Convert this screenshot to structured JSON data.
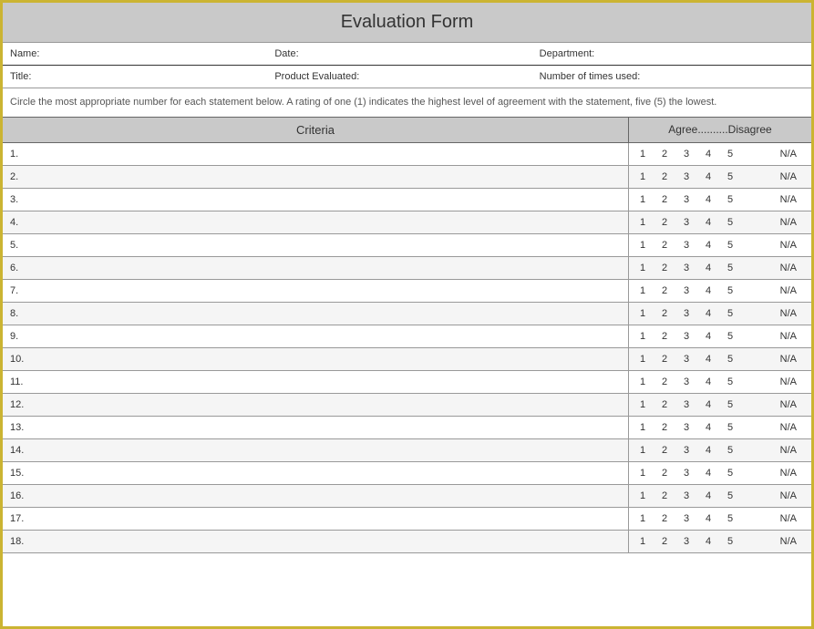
{
  "title": "Evaluation Form",
  "info": {
    "row1": {
      "field1": "Name:",
      "field2": "Date:",
      "field3": "Department:"
    },
    "row2": {
      "field1": "Title:",
      "field2": "Product Evaluated:",
      "field3": "Number of times used:"
    }
  },
  "instructions": "Circle the most appropriate number for each statement below. A rating of one (1) indicates the highest level of agreement with  the statement, five (5) the lowest.",
  "headers": {
    "criteria": "Criteria",
    "scale": "Agree..........Disagree"
  },
  "scale": {
    "n1": "1",
    "n2": "2",
    "n3": "3",
    "n4": "4",
    "n5": "5",
    "na": "N/A"
  },
  "rows": [
    {
      "num": "1."
    },
    {
      "num": "2."
    },
    {
      "num": "3."
    },
    {
      "num": "4."
    },
    {
      "num": "5."
    },
    {
      "num": "6."
    },
    {
      "num": "7."
    },
    {
      "num": "8."
    },
    {
      "num": "9."
    },
    {
      "num": "10."
    },
    {
      "num": "11."
    },
    {
      "num": "12."
    },
    {
      "num": "13."
    },
    {
      "num": "14."
    },
    {
      "num": "15."
    },
    {
      "num": "16."
    },
    {
      "num": "17."
    },
    {
      "num": "18."
    }
  ]
}
